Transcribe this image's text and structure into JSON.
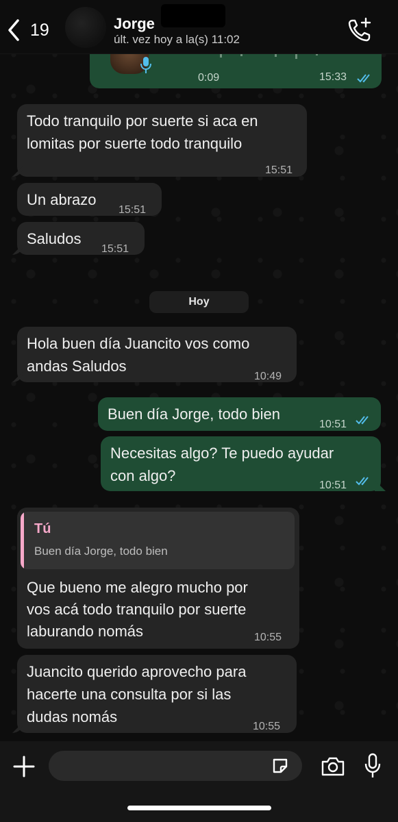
{
  "header": {
    "back_count": "19",
    "contact_name": "Jorge",
    "last_seen": "últ. vez hoy a la(s) 11:02"
  },
  "voice_note": {
    "duration": "0:09",
    "time": "15:33"
  },
  "messages": [
    {
      "direction": "incoming",
      "text_line1": "Todo tranquilo por suerte si aca en",
      "text_line2": "lomitas por suerte todo tranquilo",
      "time": "15:51"
    },
    {
      "direction": "incoming",
      "text": "Un abrazo",
      "time": "15:51"
    },
    {
      "direction": "incoming",
      "text": "Saludos",
      "time": "15:51"
    },
    {
      "direction": "incoming",
      "text_line1": "Hola buen día Juancito vos como",
      "text_line2": "andas Saludos",
      "time": "10:49"
    },
    {
      "direction": "outgoing",
      "text": "Buen día Jorge, todo bien",
      "time": "10:51"
    },
    {
      "direction": "outgoing",
      "text_line1": "Necesitas algo? Te puedo ayudar",
      "text_line2": "con algo?",
      "time": "10:51"
    },
    {
      "direction": "incoming",
      "reply_author": "Tú",
      "reply_text": "Buen día Jorge, todo bien",
      "text_line1": "Que bueno me alegro mucho por",
      "text_line2": "vos acá todo tranquilo por suerte",
      "text_line3": "laburando nomás",
      "time": "10:55"
    },
    {
      "direction": "incoming",
      "text_line1": "Juancito querido aprovecho para",
      "text_line2": "hacerte una consulta por si las",
      "text_line3": "dudas nomás",
      "time": "10:55"
    }
  ],
  "date_separator": "Hoy",
  "composer": {
    "placeholder": ""
  },
  "colors": {
    "outgoing_bubble": "#1f4d34",
    "incoming_bubble": "#252525",
    "read_ticks": "#53bdeb",
    "reply_accent": "#f6a8c9"
  },
  "icons": [
    "back-chevron-icon",
    "call-add-icon",
    "mic-icon",
    "read-ticks-icon",
    "plus-icon",
    "sticker-icon",
    "camera-icon"
  ]
}
